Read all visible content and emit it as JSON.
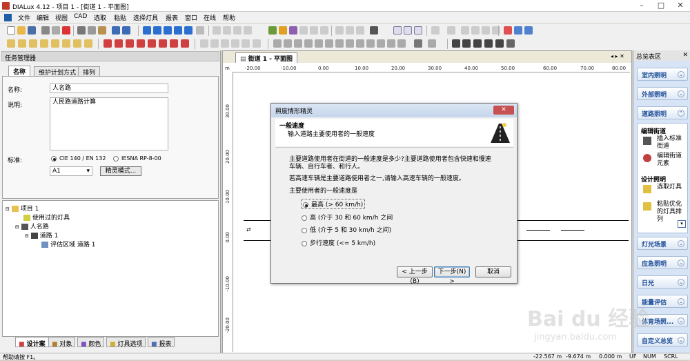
{
  "window": {
    "title": "DIALux 4.12 - 项目 1 - [街道 1 - 平面图]"
  },
  "menu": [
    "文件",
    "编辑",
    "视图",
    "CAD",
    "选取",
    "粘贴",
    "选择灯具",
    "报表",
    "窗口",
    "在线",
    "帮助"
  ],
  "left_panel": {
    "header": "任务管理器",
    "tabs": [
      "名称",
      "维护计划方式",
      "排列"
    ],
    "name_label": "名称:",
    "name_value": "人名路",
    "desc_label": "说明:",
    "desc_value": "人民路道路计算",
    "standard_label": "标准:",
    "standard_opt1": "CIE 140 / EN 13201",
    "standard_opt2": "IESNA RP-8-00",
    "class_value": "A1",
    "wizard_button": "精灵模式...",
    "tree": [
      "项目 1",
      "使用过的灯具",
      "人名路",
      "道路 1",
      "评估区域 道路 1"
    ],
    "bottom_tabs": [
      "设计案",
      "对象",
      "颜色",
      "灯具选项",
      "报表"
    ]
  },
  "center": {
    "doc_tab": "街道 1 - 平面图",
    "ruler_unit": "m",
    "h_ticks": [
      "-20.00",
      "-10.00",
      "0.00",
      "10.00",
      "20.00",
      "30.00",
      "40.00",
      "50.00",
      "60.00",
      "70.00",
      "80.00"
    ],
    "v_ticks": [
      "30.00",
      "20.00",
      "10.00",
      "0.00",
      "-10.00",
      "-20.00"
    ]
  },
  "right_panel": {
    "header": "总览表区",
    "buttons": [
      "室内照明",
      "外部照明",
      "道路照明",
      "灯光场景",
      "应急照明",
      "日光",
      "能量评估",
      "体育场照...",
      "自定义总览"
    ],
    "road_section": {
      "edit_title": "编辑街道",
      "edit_items": [
        "插入标准街道",
        "编辑街道元素"
      ],
      "design_title": "设计照明",
      "design_items": [
        "选取灯具",
        "粘贴优化的灯具排列"
      ]
    }
  },
  "dialog": {
    "title": "照度情形精灵",
    "close_label": "关闭",
    "heading": "一般速度",
    "subheading": "输入道路主要使用者的一般速度",
    "para1": "主要道路使用者在街道的一般速度是多少?主要道路使用者包含快速和慢速车辆、自行车者、和行人。",
    "para2": "若高速车辆是主要道路使用者之一,请输入高速车辆的一般速度。",
    "question": "主要使用者的一般速度是",
    "options": [
      "最高 (> 60 km/h)",
      "高 (介于 30 和 60 km/h 之间",
      "低 (介于 5 和 30 km/h 之间)",
      "步行速度 (<= 5 km/h)"
    ],
    "selected_index": 0,
    "btn_back": "< 上一步(B)",
    "btn_next": "下一步(N) >",
    "btn_cancel": "取消"
  },
  "status": {
    "help": "帮助请按 F1。",
    "x": "-22.567 m",
    "y": "-9.674 m",
    "z": "0.000 m",
    "uf": "UF",
    "num": "NUM",
    "scrl": "SCRL"
  },
  "watermark": {
    "text": "Bai du 经验",
    "url": "jingyan.baidu.com"
  }
}
